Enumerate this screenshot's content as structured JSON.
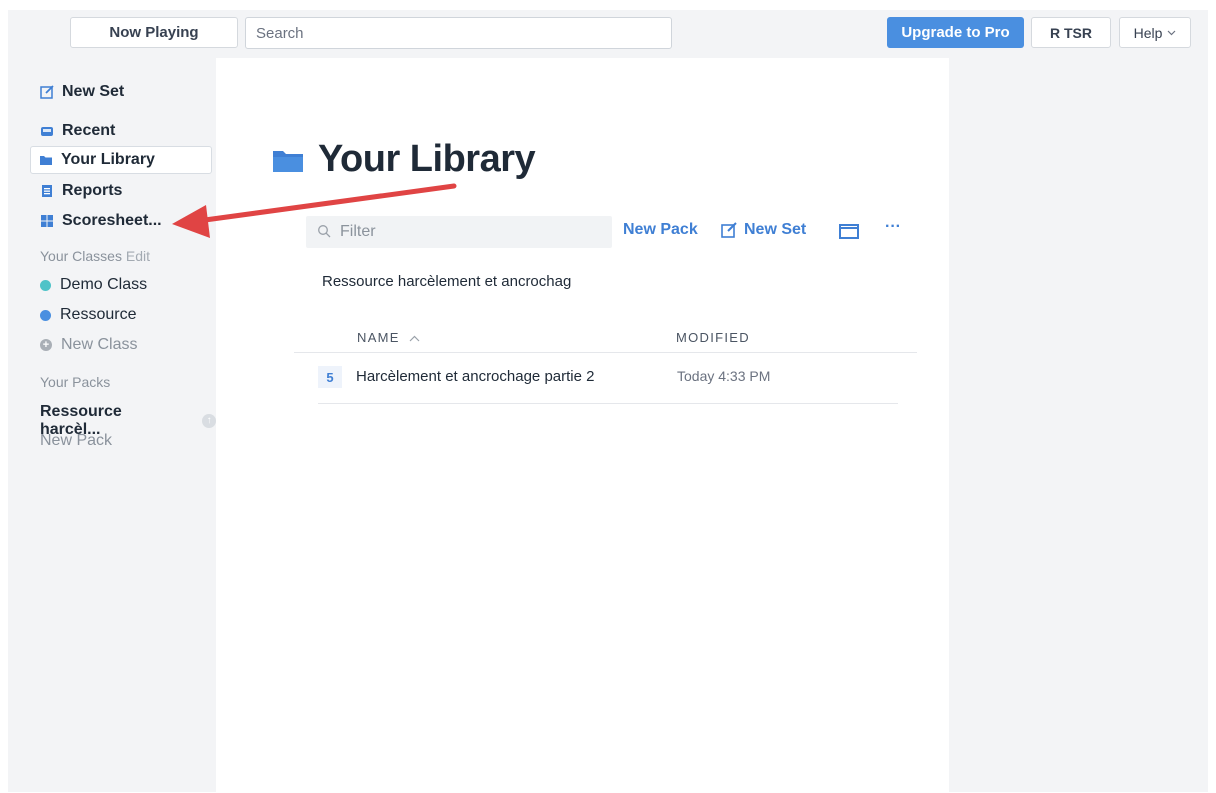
{
  "topbar": {
    "now_playing": "Now Playing",
    "search_placeholder": "Search",
    "upgrade": "Upgrade to Pro",
    "user": "R TSR",
    "help": "Help"
  },
  "sidebar": {
    "new_set": "New Set",
    "recent": "Recent",
    "your_library": "Your Library",
    "reports": "Reports",
    "scoresheet": "Scoresheet...",
    "classes_header": "Your Classes",
    "classes_edit": "Edit",
    "classes": [
      {
        "label": "Demo Class",
        "color": "#4fc3c8"
      },
      {
        "label": "Ressource",
        "color": "#4a8fe0"
      }
    ],
    "new_class": "New Class",
    "packs_header": "Your Packs",
    "pack": "Ressource harcèl...",
    "new_pack": "New Pack"
  },
  "main": {
    "title": "Your Library",
    "filter_placeholder": "Filter",
    "new_pack": "New Pack",
    "new_set": "New Set",
    "more": "···",
    "pack_chip": "Ressource harcèlement et ancrochag",
    "columns": {
      "name": "NAME",
      "modified": "MODIFIED"
    },
    "rows": [
      {
        "count": "5",
        "name": "Harcèlement et ancrochage partie 2",
        "modified": "Today 4:33 PM"
      }
    ]
  },
  "colors": {
    "accent": "#4a8fe0",
    "link": "#3f7fd4",
    "annotation_arrow": "#e04444"
  }
}
